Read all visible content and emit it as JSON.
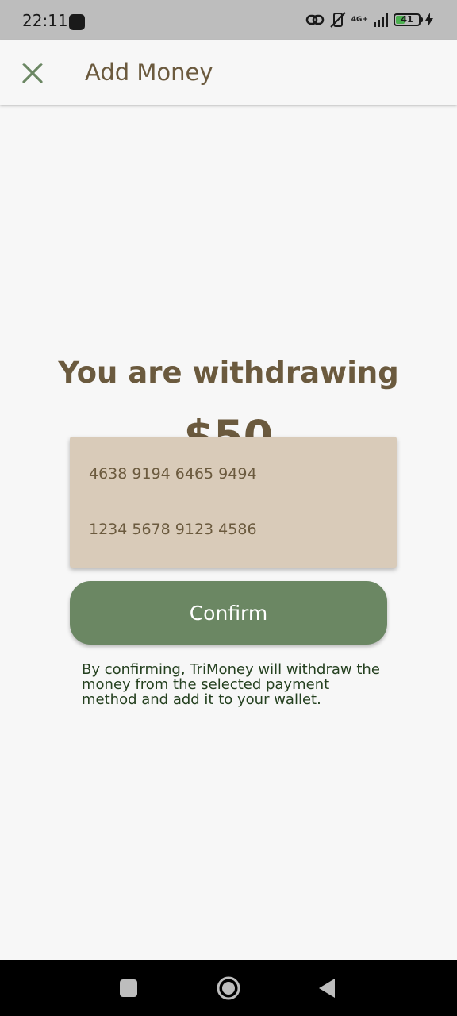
{
  "status_bar": {
    "time": "22:11",
    "network_label": "4G+",
    "battery_level": "41",
    "battery_fraction": 0.41
  },
  "app_bar": {
    "title": "Add Money",
    "close_icon": "close-icon"
  },
  "withdraw": {
    "headline": "You are withdrawing",
    "amount": "$50"
  },
  "dropdown": {
    "options": [
      "4638 9194 6465 9494",
      "1234 5678 9123 4586"
    ]
  },
  "confirm_button": {
    "label": "Confirm"
  },
  "disclaimer": "By confirming, TriMoney will withdraw the money from the selected payment method and add it to your wallet.",
  "colors": {
    "primary_green": "#6b8763",
    "brown_text": "#6b5a3e",
    "dropdown_bg": "#d9cbb9",
    "background": "#f7f7f7"
  },
  "nav_bar": {
    "icons": [
      "recents-icon",
      "home-icon",
      "back-icon"
    ]
  }
}
